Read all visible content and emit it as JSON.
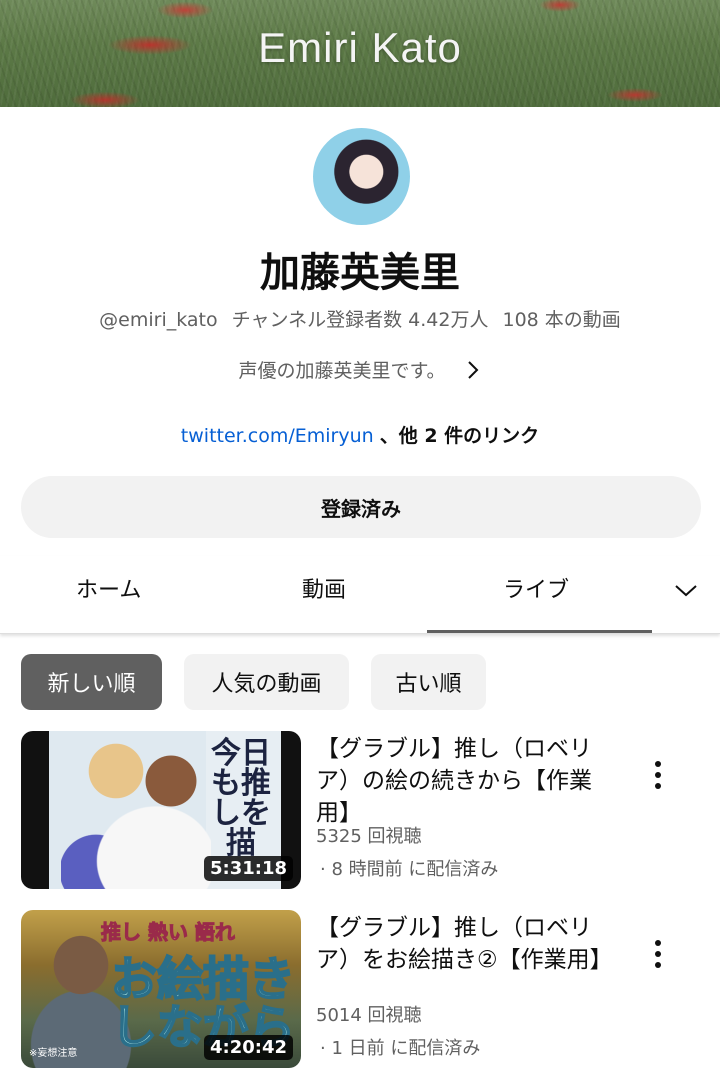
{
  "banner": {
    "title": "Emiri Kato"
  },
  "channel": {
    "name": "加藤英美里",
    "handle": "@emiri_kato",
    "subscribers": "チャンネル登録者数 4.42万人",
    "video_count": "108 本の動画",
    "description": "声優の加藤英美里です。",
    "link_text": "twitter.com/Emiryun",
    "link_more": "、他 2 件のリンク"
  },
  "subscribe": {
    "label": "登録済み"
  },
  "tabs": [
    {
      "label": "ホーム",
      "active": false
    },
    {
      "label": "動画",
      "active": false
    },
    {
      "label": "ライブ",
      "active": true
    }
  ],
  "chips": [
    {
      "label": "新しい順",
      "active": true
    },
    {
      "label": "人気の動画",
      "active": false
    },
    {
      "label": "古い順",
      "active": false
    }
  ],
  "videos": [
    {
      "title": "【グラブル】推し（ロベリア）の絵の続きから【作業用】",
      "views": "5325 回視聴",
      "time": "· 8 時間前 に配信済み",
      "duration": "5:31:18",
      "thumb_text": "今日も推しを描",
      "thumb_small": "推し"
    },
    {
      "title": "【グラブル】推し（ロベリア）をお絵描き②【作業用】",
      "views": "5014 回視聴",
      "time": "· 1 日前 に配信済み",
      "duration": "4:20:42",
      "thumb_top": "推し 熱い 語れ",
      "thumb_big": "お絵描き しながら",
      "thumb_note": "※妄想注意"
    }
  ],
  "colors": {
    "link": "#065fd4",
    "secondary_text": "#606060",
    "chip_active": "#606060",
    "chip_inactive": "#f2f2f2"
  }
}
